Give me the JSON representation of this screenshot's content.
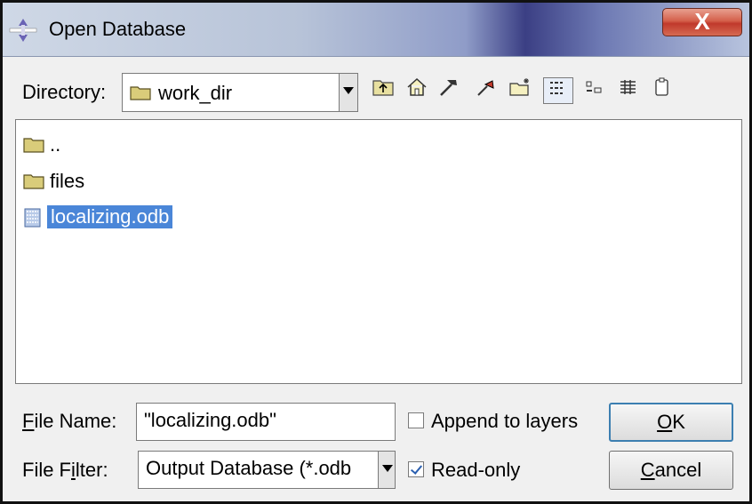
{
  "window": {
    "title": "Open Database",
    "close_label": "X"
  },
  "directory": {
    "label": "Directory:",
    "value": "work_dir",
    "toolbar": [
      "up-folder-icon",
      "home-icon",
      "hammer-icon",
      "bookmark-icon",
      "new-folder-icon",
      "list-view-icon",
      "small-icons-icon",
      "details-view-icon",
      "clipboard-icon"
    ]
  },
  "files": [
    {
      "name": "..",
      "type": "folder"
    },
    {
      "name": "files",
      "type": "folder"
    },
    {
      "name": "localizing.odb",
      "type": "file",
      "selected": true
    }
  ],
  "file_name": {
    "label_prefix": "F",
    "label_rest": "ile Name:",
    "value": "\"localizing.odb\""
  },
  "file_filter": {
    "label_prefix": "File F",
    "label_u": "i",
    "label_rest": "lter:",
    "value": "Output Database (*.odb"
  },
  "append_layers": {
    "label": "Append to layers",
    "checked": false
  },
  "read_only": {
    "label": "Read-only",
    "checked": true
  },
  "ok_button": {
    "label_u": "O",
    "label_rest": "K"
  },
  "cancel_button": {
    "label_u": "C",
    "label_rest": "ancel"
  }
}
